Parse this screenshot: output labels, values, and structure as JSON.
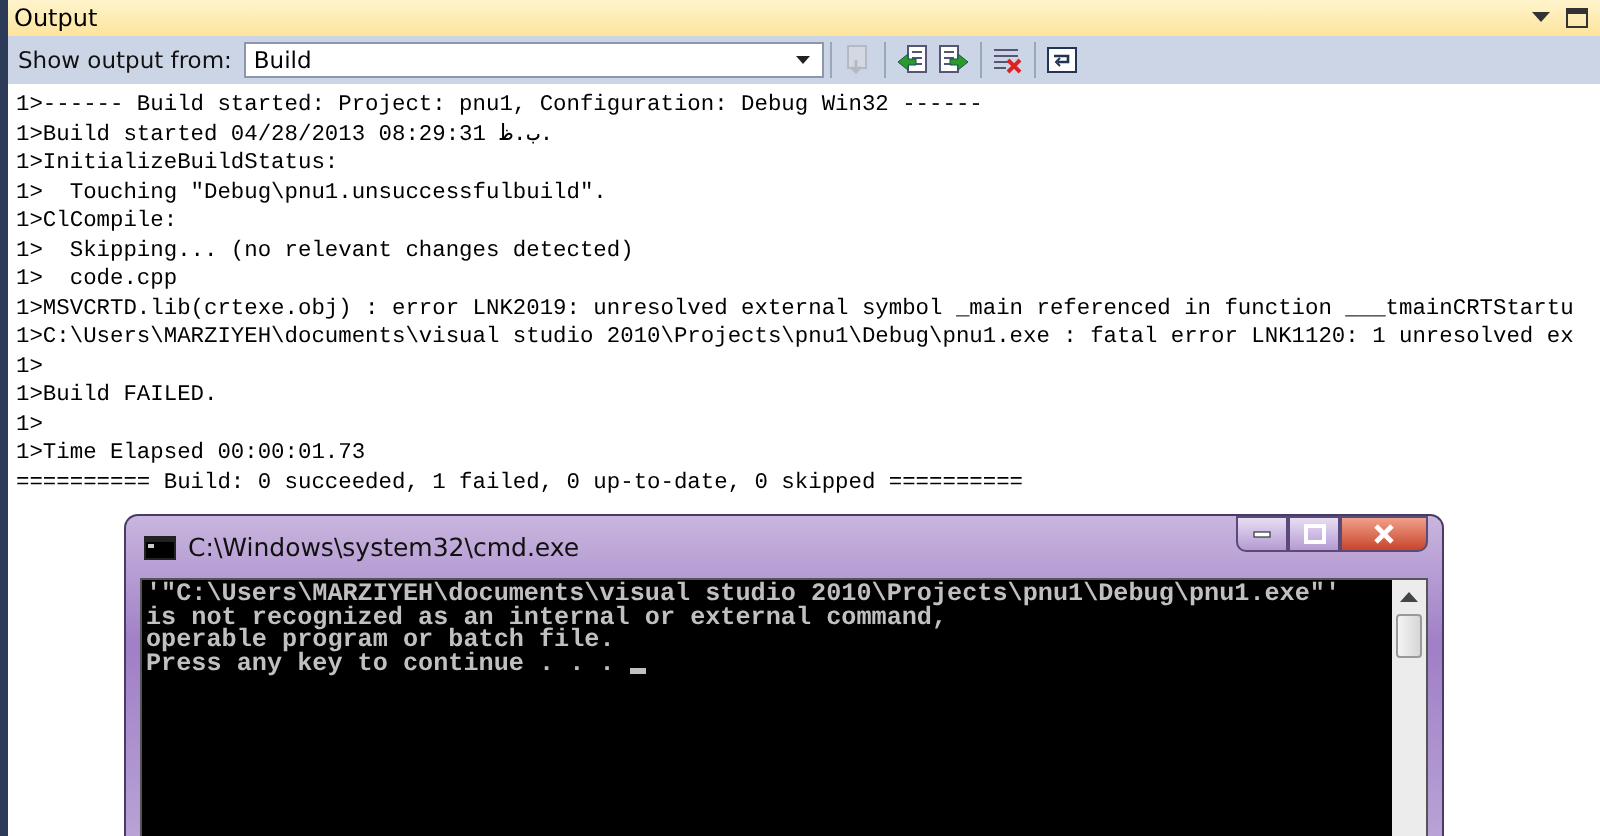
{
  "panel": {
    "title": "Output"
  },
  "toolbar": {
    "label": "Show output from:",
    "source": "Build",
    "buttons": [
      {
        "kind": "goto",
        "disabled": true
      },
      {
        "kind": "previous",
        "disabled": false
      },
      {
        "kind": "next",
        "disabled": false
      },
      {
        "kind": "clear",
        "disabled": false
      },
      {
        "kind": "wrap",
        "disabled": false
      }
    ]
  },
  "output_lines": [
    "1>------ Build started: Project: pnu1, Configuration: Debug Win32 ------",
    "1>Build started 04/28/2013 08:29:31 ب.ظ.",
    "1>InitializeBuildStatus:",
    "1>  Touching \"Debug\\pnu1.unsuccessfulbuild\".",
    "1>ClCompile:",
    "1>  Skipping... (no relevant changes detected)",
    "1>  code.cpp",
    "1>MSVCRTD.lib(crtexe.obj) : error LNK2019: unresolved external symbol _main referenced in function ___tmainCRTStartu",
    "1>C:\\Users\\MARZIYEH\\documents\\visual studio 2010\\Projects\\pnu1\\Debug\\pnu1.exe : fatal error LNK1120: 1 unresolved ex",
    "1>",
    "1>Build FAILED.",
    "1>",
    "1>Time Elapsed 00:00:01.73",
    "========== Build: 0 succeeded, 1 failed, 0 up-to-date, 0 skipped =========="
  ],
  "console_window": {
    "title": "C:\\Windows\\system32\\cmd.exe",
    "lines": [
      "'\"C:\\Users\\MARZIYEH\\documents\\visual studio 2010\\Projects\\pnu1\\Debug\\pnu1.exe\"'",
      "is not recognized as an internal or external command,",
      "operable program or batch file.",
      "Press any key to continue . . . "
    ]
  }
}
